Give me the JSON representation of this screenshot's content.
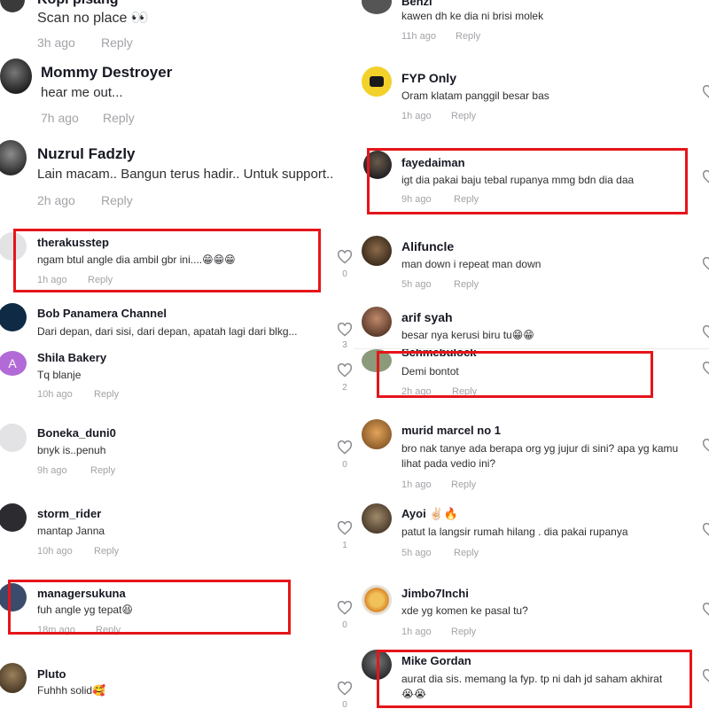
{
  "colors": {
    "highlight": "#e5151a",
    "meta": "#a3a3a8",
    "text": "#161823"
  },
  "left_comments": [
    {
      "username": "Kopi pisang",
      "text": "Scan no place 👀",
      "time": "3h ago",
      "reply": "Reply"
    },
    {
      "username": "Mommy Destroyer",
      "text": "hear me out...",
      "time": "7h ago",
      "reply": "Reply"
    },
    {
      "username": "Nuzrul Fadzly",
      "text": "Lain macam.. Bangun terus hadir.. Untuk support..",
      "time": "2h ago",
      "reply": "Reply"
    },
    {
      "username": "therakusstep",
      "text": "ngam btul angle dia ambil gbr ini....😁😁😁",
      "time": "1h ago",
      "reply": "Reply",
      "likes": "0"
    },
    {
      "username": "Bob Panamera Channel",
      "text": "Dari depan, dari sisi, dari depan, apatah lagi dari blkg...",
      "likes": "3"
    },
    {
      "username": "Shila Bakery",
      "text": "Tq blanje",
      "time": "10h ago",
      "reply": "Reply",
      "likes": "2"
    },
    {
      "username": "Boneka_duni0",
      "text": "bnyk is..penuh",
      "time": "9h ago",
      "reply": "Reply",
      "likes": "0"
    },
    {
      "username": "storm_rider",
      "text": "mantap Janna",
      "time": "10h ago",
      "reply": "Reply",
      "likes": "1"
    },
    {
      "username": "managersukuna",
      "text": "fuh angle yg tepat😆",
      "time": "18m ago",
      "reply": "Reply",
      "likes": "0"
    },
    {
      "username": "Pluto",
      "text": "Fuhhh solid🥰",
      "likes": "0"
    }
  ],
  "right_comments": [
    {
      "username": "Benzi",
      "text": "kawen dh ke dia ni brisi molek",
      "time": "11h ago",
      "reply": "Reply"
    },
    {
      "username": "FYP Only",
      "text": "Oram klatam panggil besar bas",
      "time": "1h ago",
      "reply": "Reply"
    },
    {
      "username": "fayedaiman",
      "text": "igt dia pakai baju tebal rupanya mmg bdn dia daa",
      "time": "9h ago",
      "reply": "Reply"
    },
    {
      "username": "Alifuncle",
      "text": "man down i repeat man down",
      "time": "5h ago",
      "reply": "Reply"
    },
    {
      "username": "arif syah",
      "text": "besar nya kerusi biru tu😁😁"
    },
    {
      "username": "Schmebulock",
      "text": "Demi bontot",
      "time": "2h ago",
      "reply": "Reply"
    },
    {
      "username": "murid marcel no 1",
      "text": "bro nak tanye ada berapa org yg jujur di sini? apa yg kamu lihat pada vedio ini?",
      "time": "1h ago",
      "reply": "Reply"
    },
    {
      "username": "Ayoi ✌🏻🔥",
      "text": "patut la langsir rumah hilang . dia pakai rupanya",
      "time": "5h ago",
      "reply": "Reply"
    },
    {
      "username": "Jimbo7Inchi",
      "text": "xde yg komen ke pasal tu?",
      "time": "1h ago",
      "reply": "Reply"
    },
    {
      "username": "Mike Gordan",
      "text": "aurat dia sis. memang la fyp. tp ni dah jd saham akhirat 😭😭"
    }
  ]
}
